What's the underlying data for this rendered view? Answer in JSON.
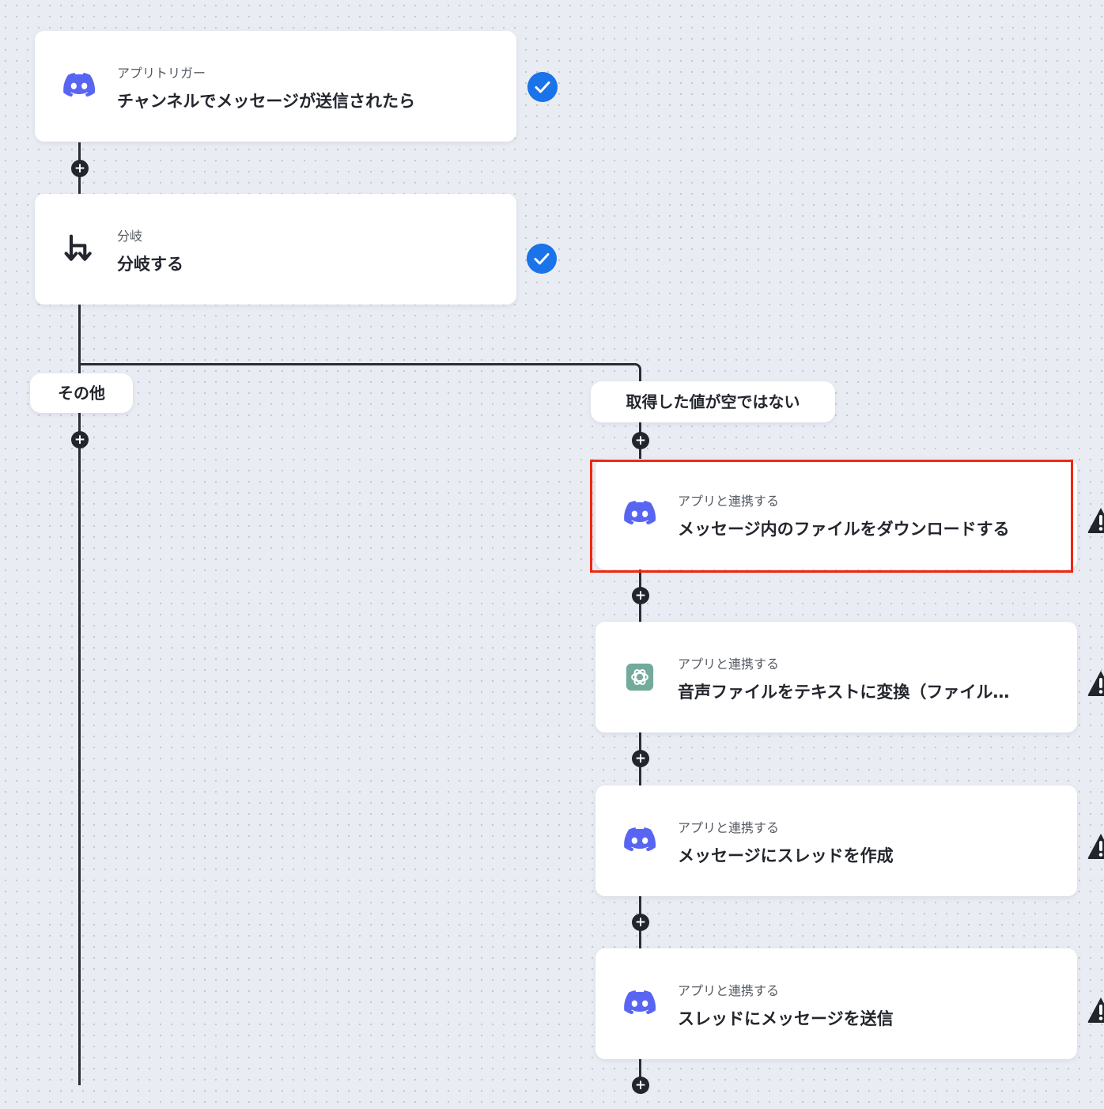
{
  "steps": [
    {
      "subtitle": "アプリトリガー",
      "title": "チャンネルでメッセージが送信されたら",
      "icon": "discord-icon",
      "status": "complete"
    },
    {
      "subtitle": "分岐",
      "title": "分岐する",
      "icon": "branch-icon",
      "status": "complete"
    }
  ],
  "branches": {
    "left_label": "その他",
    "right_label": "取得した値が空ではない"
  },
  "right_steps": [
    {
      "subtitle": "アプリと連携する",
      "title": "メッセージ内のファイルをダウンロードする",
      "icon": "discord-icon",
      "status": "warning",
      "highlighted": true
    },
    {
      "subtitle": "アプリと連携する",
      "title": "音声ファイルをテキストに変換（ファイル添...",
      "icon": "chatgpt-icon",
      "status": "warning"
    },
    {
      "subtitle": "アプリと連携する",
      "title": "メッセージにスレッドを作成",
      "icon": "discord-icon",
      "status": "warning"
    },
    {
      "subtitle": "アプリと連携する",
      "title": "スレッドにメッセージを送信",
      "icon": "discord-icon",
      "status": "warning"
    }
  ],
  "colors": {
    "background": "#e9ecf3",
    "connector": "#2a2d34",
    "check": "#1a73e8",
    "highlight": "#f0270f",
    "discord": "#5865f2",
    "chatgpt": "#74aa9c"
  }
}
